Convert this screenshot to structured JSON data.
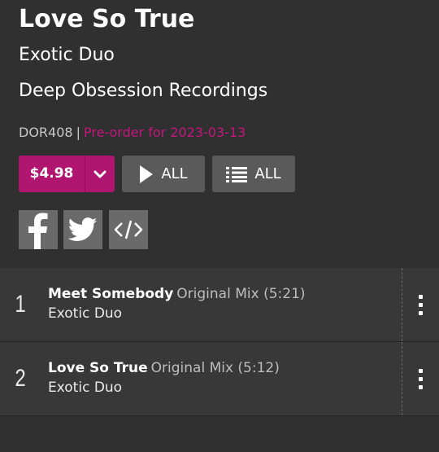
{
  "release": {
    "title": "Love So True",
    "artist": "Exotic Duo",
    "label": "Deep Obsession Recordings",
    "catalog": "DOR408",
    "separator": "|",
    "preorder_text": "Pre-order for 2023-03-13"
  },
  "actions": {
    "price": "$4.98",
    "play_all_label": "ALL",
    "queue_all_label": "ALL"
  },
  "social": {
    "icons": [
      "facebook-icon",
      "twitter-icon",
      "embed-icon"
    ]
  },
  "tracks": [
    {
      "number": "1",
      "name": "Meet Somebody",
      "mix": "Original Mix (5:21)",
      "artist": "Exotic Duo"
    },
    {
      "number": "2",
      "name": "Love So True",
      "mix": "Original Mix (5:12)",
      "artist": "Exotic Duo"
    }
  ],
  "colors": {
    "accent": "#b0166f",
    "preorder": "#c4167d",
    "background": "#303030",
    "track_row": "#383838",
    "button_gray": "#5a5a5a",
    "social_gray": "#6a6a6a"
  }
}
